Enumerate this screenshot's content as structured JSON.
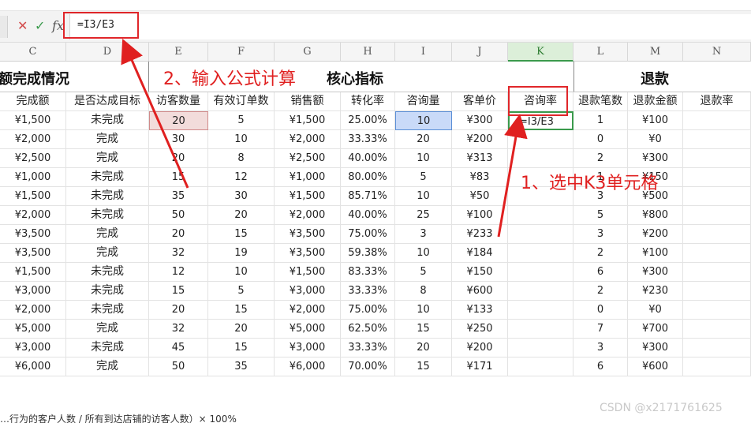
{
  "formula_bar": {
    "cancel_icon": "close-icon",
    "confirm_icon": "check-icon",
    "fx_label": "fx",
    "formula": "=I3/E3"
  },
  "columns": [
    "C",
    "D",
    "E",
    "F",
    "G",
    "H",
    "I",
    "J",
    "K",
    "L",
    "M",
    "N"
  ],
  "active_column": "K",
  "titles": {
    "left": "销售额完成情况",
    "core": "核心指标",
    "refund": "退款"
  },
  "headers": [
    "完成额",
    "是否达成目标",
    "访客数量",
    "有效订单数",
    "销售额",
    "转化率",
    "咨询量",
    "客单价",
    "咨询率",
    "退款笔数",
    "退款金额",
    "退款率"
  ],
  "rows": [
    {
      "c": "¥1,500",
      "d": "未完成",
      "e": "20",
      "f": "5",
      "g": "¥1,500",
      "h": "25.00%",
      "i": "10",
      "j": "¥300",
      "k": "=I3/E3",
      "l": "1",
      "m": "¥100",
      "n": ""
    },
    {
      "c": "¥2,000",
      "d": "完成",
      "e": "30",
      "f": "10",
      "g": "¥2,000",
      "h": "33.33%",
      "i": "20",
      "j": "¥200",
      "k": "",
      "l": "0",
      "m": "¥0",
      "n": ""
    },
    {
      "c": "¥2,500",
      "d": "完成",
      "e": "20",
      "f": "8",
      "g": "¥2,500",
      "h": "40.00%",
      "i": "10",
      "j": "¥313",
      "k": "",
      "l": "2",
      "m": "¥300",
      "n": ""
    },
    {
      "c": "¥1,000",
      "d": "未完成",
      "e": "15",
      "f": "12",
      "g": "¥1,000",
      "h": "80.00%",
      "i": "5",
      "j": "¥83",
      "k": "",
      "l": "1",
      "m": "¥150",
      "n": ""
    },
    {
      "c": "¥1,500",
      "d": "未完成",
      "e": "35",
      "f": "30",
      "g": "¥1,500",
      "h": "85.71%",
      "i": "10",
      "j": "¥50",
      "k": "",
      "l": "3",
      "m": "¥500",
      "n": ""
    },
    {
      "c": "¥2,000",
      "d": "未完成",
      "e": "50",
      "f": "20",
      "g": "¥2,000",
      "h": "40.00%",
      "i": "25",
      "j": "¥100",
      "k": "",
      "l": "5",
      "m": "¥800",
      "n": ""
    },
    {
      "c": "¥3,500",
      "d": "完成",
      "e": "20",
      "f": "15",
      "g": "¥3,500",
      "h": "75.00%",
      "i": "3",
      "j": "¥233",
      "k": "",
      "l": "3",
      "m": "¥200",
      "n": ""
    },
    {
      "c": "¥3,500",
      "d": "完成",
      "e": "32",
      "f": "19",
      "g": "¥3,500",
      "h": "59.38%",
      "i": "10",
      "j": "¥184",
      "k": "",
      "l": "2",
      "m": "¥100",
      "n": ""
    },
    {
      "c": "¥1,500",
      "d": "未完成",
      "e": "12",
      "f": "10",
      "g": "¥1,500",
      "h": "83.33%",
      "i": "5",
      "j": "¥150",
      "k": "",
      "l": "6",
      "m": "¥300",
      "n": ""
    },
    {
      "c": "¥3,000",
      "d": "未完成",
      "e": "15",
      "f": "5",
      "g": "¥3,000",
      "h": "33.33%",
      "i": "8",
      "j": "¥600",
      "k": "",
      "l": "2",
      "m": "¥230",
      "n": ""
    },
    {
      "c": "¥2,000",
      "d": "未完成",
      "e": "20",
      "f": "15",
      "g": "¥2,000",
      "h": "75.00%",
      "i": "10",
      "j": "¥133",
      "k": "",
      "l": "0",
      "m": "¥0",
      "n": ""
    },
    {
      "c": "¥5,000",
      "d": "完成",
      "e": "32",
      "f": "20",
      "g": "¥5,000",
      "h": "62.50%",
      "i": "15",
      "j": "¥250",
      "k": "",
      "l": "7",
      "m": "¥700",
      "n": ""
    },
    {
      "c": "¥3,000",
      "d": "未完成",
      "e": "45",
      "f": "15",
      "g": "¥3,000",
      "h": "33.33%",
      "i": "20",
      "j": "¥200",
      "k": "",
      "l": "3",
      "m": "¥300",
      "n": ""
    },
    {
      "c": "¥6,000",
      "d": "完成",
      "e": "50",
      "f": "35",
      "g": "¥6,000",
      "h": "70.00%",
      "i": "15",
      "j": "¥171",
      "k": "",
      "l": "6",
      "m": "¥600",
      "n": ""
    }
  ],
  "annotations": {
    "step2": "2、输入公式计算",
    "step1": "1、选中K3单元格",
    "colors": {
      "red": "#e02020",
      "highlight_e": "#f2dcdb",
      "highlight_i": "#c9daf8",
      "selection": "#3a9a4c"
    }
  },
  "footer": "…行为的客户人数 / 所有到达店铺的访客人数）× 100%",
  "watermark": "CSDN @x2171761625"
}
